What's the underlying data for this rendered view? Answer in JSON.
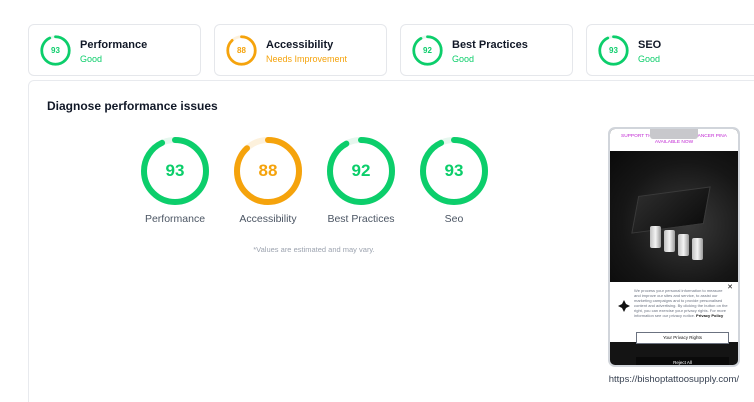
{
  "summary_cards": [
    {
      "score": "93",
      "title": "Performance",
      "status": "Good",
      "color": "#0cce6b",
      "fraction": 0.93
    },
    {
      "score": "88",
      "title": "Accessibility",
      "status": "Needs Improvement",
      "color": "#f5a30c",
      "fraction": 0.88
    },
    {
      "score": "92",
      "title": "Best Practices",
      "status": "Good",
      "color": "#0cce6b",
      "fraction": 0.92
    },
    {
      "score": "93",
      "title": "SEO",
      "status": "Good",
      "color": "#0cce6b",
      "fraction": 0.93
    }
  ],
  "panel": {
    "title": "Diagnose performance issues",
    "gauges": [
      {
        "score": "93",
        "label": "Performance",
        "color": "#0cce6b",
        "fraction": 0.93
      },
      {
        "score": "88",
        "label": "Accessibility",
        "color": "#f5a30c",
        "fraction": 0.88
      },
      {
        "score": "92",
        "label": "Best Practices",
        "color": "#0cce6b",
        "fraction": 0.92
      },
      {
        "score": "93",
        "label": "Seo",
        "color": "#0cce6b",
        "fraction": 0.93
      }
    ],
    "note": "*Values are estimated and may vary."
  },
  "preview": {
    "banner_text": "SUPPORT TH... ...T3 - HOPE VIL CANCER PINA AVAILABLE NOW",
    "cookie_text": "We process your personal information to measure and improve our sites and service, to assist our marketing campaigns and to provide personalised content and advertising. By clicking the button on the right, you can exercise your privacy rights. For more information see our privacy notice.",
    "privacy_link": "Privacy Policy",
    "privacy_button": "Your Privacy Rights",
    "reject_button": "Reject All",
    "close_icon": "close-icon",
    "url": "https://bishoptattoosupply.com/"
  },
  "colors": {
    "good": "#0cce6b",
    "average": "#f5a30c",
    "track": "#e6f7ee"
  }
}
